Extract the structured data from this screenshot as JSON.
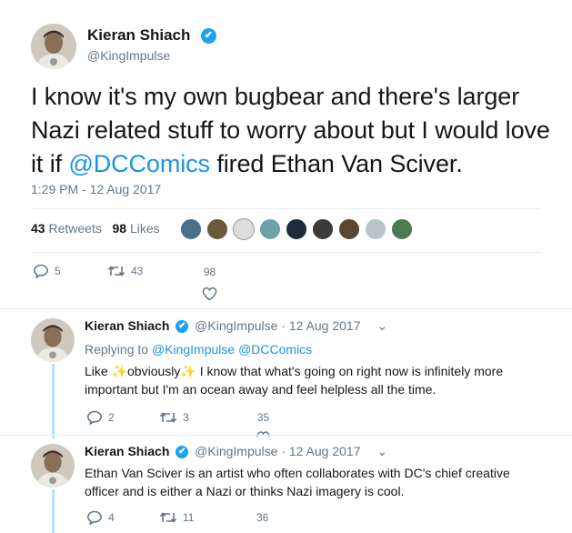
{
  "main_tweet": {
    "name": "Kieran Shiach",
    "handle": "@KingImpulse",
    "text_before": "I know it's my own bugbear and there's larger Nazi related stuff to worry about but I would love it if ",
    "mention": "@DCComics",
    "text_after": " fired Ethan Van Sciver.",
    "timestamp": "1:29 PM - 12 Aug 2017",
    "retweets_count": "43",
    "retweets_label": "Retweets",
    "likes_count": "98",
    "likes_label": "Likes",
    "actions": {
      "replies": "5",
      "retweets": "43",
      "likes": "98"
    }
  },
  "replies": [
    {
      "name": "Kieran Shiach",
      "handle": "@KingImpulse",
      "date": "· 12 Aug 2017",
      "replying_label": "Replying to",
      "replying_to": "@KingImpulse @DCComics",
      "text_a": "Like ",
      "emoji_1": "✨",
      "text_b": "obviously",
      "emoji_2": "✨",
      "text_c": " I know that what's going on right now is infinitely more important but I'm an ocean away and feel helpless all the time.",
      "actions": {
        "replies": "2",
        "retweets": "3",
        "likes": "35"
      }
    },
    {
      "name": "Kieran Shiach",
      "handle": "@KingImpulse",
      "date": "· 12 Aug 2017",
      "text": "Ethan Van Sciver is an artist who often collaborates with DC's chief creative officer and is either a Nazi or thinks Nazi imagery is cool.",
      "actions": {
        "replies": "4",
        "retweets": "11",
        "likes": "36"
      }
    }
  ],
  "icons": {
    "verified": "✔",
    "chevron": "⌄"
  },
  "colors": {
    "link": "#1b95e0",
    "verified": "#1da1f2",
    "thread_line": "#b7e2f5",
    "muted": "#657786"
  }
}
